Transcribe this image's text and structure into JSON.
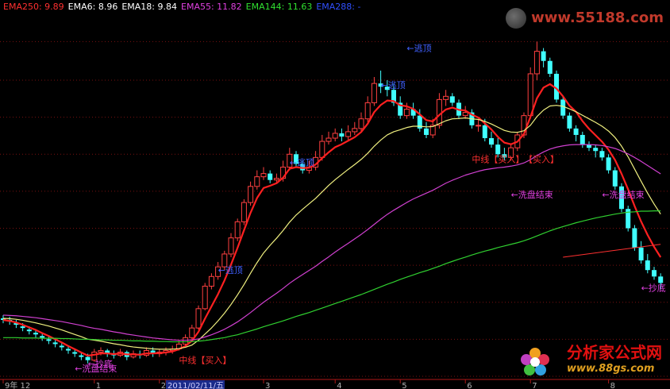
{
  "legend": [
    {
      "label": "EMA250: 9.89",
      "color": "#ff3030"
    },
    {
      "label": "EMA6: 8.96",
      "color": "#ffffff"
    },
    {
      "label": "EMA18: 9.84",
      "color": "#ffffff"
    },
    {
      "label": "EMA55: 11.82",
      "color": "#e040e0"
    },
    {
      "label": "EMA144: 11.63",
      "color": "#30e030"
    },
    {
      "label": "EMA288: -",
      "color": "#3050ff"
    }
  ],
  "watermark_top": "www.55188.com",
  "watermark_bottom_name": "分析家公式网",
  "watermark_bottom_url": "www.88gs.com",
  "annotations": [
    {
      "text": "←逃顶",
      "color": "#4060ff",
      "ci": 62,
      "price": 14.9
    },
    {
      "text": "←逃顶",
      "color": "#4060ff",
      "ci": 58,
      "price": 13.75
    },
    {
      "text": "←逃顶",
      "color": "#4060ff",
      "ci": 44,
      "price": 11.35
    },
    {
      "text": "←逃顶",
      "color": "#4060ff",
      "ci": 33,
      "price": 8.0
    },
    {
      "text": "中线【买入】",
      "color": "#ff3030",
      "ci": 72,
      "price": 11.45
    },
    {
      "text": "【买入】",
      "color": "#ff3030",
      "ci": 80,
      "price": 11.45
    },
    {
      "text": "中线【买入】",
      "color": "#ff3030",
      "ci": 27,
      "price": 5.2
    },
    {
      "text": "←洗盘结束",
      "color": "#e040e0",
      "ci": 78,
      "price": 10.35
    },
    {
      "text": "←洗盘结束",
      "color": "#e040e0",
      "ci": 92,
      "price": 10.35
    },
    {
      "text": "←抄底",
      "color": "#e040e0",
      "ci": 13,
      "price": 5.1
    },
    {
      "text": "←洗盘结束",
      "color": "#e040e0",
      "ci": 11,
      "price": 4.95
    },
    {
      "text": "←抄底",
      "color": "#e040e0",
      "ci": 98,
      "price": 7.45
    }
  ],
  "x_axis_labels": [
    {
      "text": "9年 12",
      "ci": 0
    },
    {
      "text": "1",
      "ci": 14
    },
    {
      "text": "2",
      "ci": 24
    },
    {
      "text": "2011/02/11/五",
      "ci": 25
    },
    {
      "text": "3",
      "ci": 40
    },
    {
      "text": "4",
      "ci": 51
    },
    {
      "text": "5",
      "ci": 61
    },
    {
      "text": "6",
      "ci": 71
    },
    {
      "text": "7",
      "ci": 81
    },
    {
      "text": "8",
      "ci": 93
    }
  ],
  "chart_data": {
    "type": "candlestick",
    "ylim": [
      4.7,
      16.0
    ],
    "grid_levels": [
      15.2,
      14.0,
      12.85,
      11.7,
      10.55,
      9.4,
      8.25,
      7.1,
      5.95,
      4.8
    ],
    "close": [
      6.55,
      6.5,
      6.4,
      6.3,
      6.2,
      6.1,
      6.0,
      5.9,
      5.8,
      5.7,
      5.6,
      5.5,
      5.4,
      5.3,
      5.55,
      5.6,
      5.5,
      5.45,
      5.55,
      5.4,
      5.5,
      5.45,
      5.6,
      5.5,
      5.55,
      5.6,
      5.65,
      5.8,
      6.0,
      6.3,
      6.9,
      7.6,
      7.9,
      8.2,
      8.6,
      9.1,
      9.6,
      10.2,
      10.7,
      11.0,
      11.1,
      10.9,
      10.95,
      11.3,
      11.7,
      11.4,
      11.2,
      11.3,
      11.6,
      12.1,
      12.2,
      12.35,
      12.25,
      12.4,
      12.5,
      12.8,
      13.3,
      13.9,
      13.8,
      13.7,
      13.3,
      12.9,
      13.1,
      12.9,
      12.5,
      12.3,
      12.6,
      13.4,
      13.5,
      13.3,
      12.9,
      13.0,
      12.6,
      12.6,
      12.2,
      12.0,
      11.7,
      11.6,
      11.9,
      12.3,
      12.9,
      14.2,
      14.9,
      14.6,
      14.2,
      13.4,
      12.9,
      12.5,
      12.3,
      12.0,
      11.9,
      11.8,
      11.6,
      11.2,
      10.7,
      10.0,
      9.4,
      8.8,
      8.4,
      8.1,
      7.9,
      7.7
    ],
    "open": [
      6.6,
      6.55,
      6.45,
      6.35,
      6.25,
      6.15,
      6.05,
      5.95,
      5.85,
      5.75,
      5.65,
      5.55,
      5.45,
      5.4,
      5.3,
      5.55,
      5.6,
      5.5,
      5.45,
      5.55,
      5.4,
      5.5,
      5.45,
      5.6,
      5.5,
      5.55,
      5.6,
      5.65,
      5.8,
      6.0,
      6.3,
      6.9,
      7.6,
      7.9,
      8.2,
      8.6,
      9.1,
      9.6,
      10.2,
      10.7,
      11.0,
      11.1,
      10.9,
      10.95,
      11.3,
      11.7,
      11.4,
      11.2,
      11.3,
      11.6,
      12.1,
      12.2,
      12.35,
      12.25,
      12.4,
      12.5,
      12.8,
      13.3,
      13.9,
      13.8,
      13.7,
      13.3,
      12.9,
      13.1,
      12.9,
      12.5,
      12.3,
      12.6,
      13.4,
      13.5,
      13.3,
      12.9,
      13.0,
      12.6,
      12.6,
      12.2,
      12.0,
      11.7,
      11.6,
      11.9,
      12.3,
      12.9,
      14.2,
      14.9,
      14.6,
      14.2,
      13.4,
      12.9,
      12.5,
      12.3,
      12.0,
      11.9,
      11.8,
      11.6,
      11.2,
      10.7,
      10.0,
      9.4,
      8.8,
      8.4,
      8.1,
      7.9
    ],
    "high": [
      6.7,
      6.65,
      6.55,
      6.45,
      6.35,
      6.25,
      6.15,
      6.05,
      5.95,
      5.85,
      5.75,
      5.65,
      5.55,
      5.5,
      5.65,
      5.7,
      5.65,
      5.6,
      5.65,
      5.6,
      5.6,
      5.6,
      5.7,
      5.7,
      5.65,
      5.7,
      5.75,
      5.9,
      6.1,
      6.4,
      7.0,
      7.7,
      8.0,
      8.35,
      8.7,
      9.25,
      9.7,
      10.3,
      10.85,
      11.2,
      11.3,
      11.2,
      11.1,
      11.5,
      11.9,
      11.8,
      11.5,
      11.5,
      11.8,
      12.3,
      12.4,
      12.5,
      12.5,
      12.6,
      12.7,
      13.0,
      13.5,
      14.1,
      14.3,
      14.0,
      13.9,
      13.5,
      13.3,
      13.3,
      13.1,
      12.7,
      12.8,
      13.6,
      13.7,
      13.6,
      13.4,
      13.2,
      13.1,
      12.8,
      12.8,
      12.4,
      12.2,
      11.9,
      12.0,
      12.4,
      13.0,
      14.4,
      15.2,
      15.0,
      14.7,
      14.3,
      13.5,
      13.0,
      12.6,
      12.4,
      12.1,
      12.0,
      11.9,
      11.7,
      11.3,
      10.8,
      10.1,
      9.5,
      9.0,
      8.6,
      8.2,
      8.0
    ],
    "low": [
      6.45,
      6.4,
      6.3,
      6.2,
      6.1,
      6.0,
      5.9,
      5.8,
      5.7,
      5.6,
      5.5,
      5.4,
      5.3,
      5.2,
      5.25,
      5.45,
      5.4,
      5.35,
      5.4,
      5.3,
      5.35,
      5.35,
      5.4,
      5.4,
      5.4,
      5.45,
      5.5,
      5.6,
      5.75,
      5.95,
      6.25,
      6.85,
      7.5,
      7.8,
      8.1,
      8.5,
      9.0,
      9.5,
      10.1,
      10.6,
      10.9,
      10.8,
      10.8,
      10.85,
      11.2,
      11.3,
      11.1,
      11.1,
      11.2,
      11.5,
      12.0,
      12.1,
      12.1,
      12.15,
      12.3,
      12.4,
      12.7,
      13.2,
      13.6,
      13.5,
      13.2,
      12.8,
      12.8,
      12.8,
      12.4,
      12.2,
      12.2,
      12.5,
      13.2,
      13.2,
      12.8,
      12.8,
      12.5,
      12.4,
      12.1,
      11.9,
      11.6,
      11.5,
      11.5,
      11.8,
      12.2,
      12.8,
      14.0,
      14.4,
      14.1,
      13.3,
      12.8,
      12.4,
      12.1,
      11.9,
      11.8,
      11.6,
      11.5,
      11.1,
      10.6,
      9.9,
      9.3,
      8.7,
      8.3,
      8.0,
      7.8,
      7.5
    ],
    "series": [
      {
        "name": "EMA6",
        "color": "#ff2020",
        "width": 2.2,
        "values": [
          6.55,
          6.52,
          6.47,
          6.4,
          6.32,
          6.24,
          6.14,
          6.05,
          5.95,
          5.85,
          5.74,
          5.64,
          5.54,
          5.44,
          5.47,
          5.51,
          5.51,
          5.49,
          5.51,
          5.48,
          5.48,
          5.47,
          5.51,
          5.51,
          5.52,
          5.54,
          5.57,
          5.64,
          5.74,
          5.9,
          6.18,
          6.59,
          6.97,
          7.35,
          7.78,
          8.27,
          8.79,
          9.34,
          9.88,
          10.34,
          10.65,
          10.72,
          10.8,
          10.97,
          11.25,
          11.3,
          11.27,
          11.28,
          11.38,
          11.58,
          11.76,
          11.92,
          12.01,
          12.12,
          12.23,
          12.39,
          12.65,
          13.01,
          13.23,
          13.37,
          13.35,
          13.22,
          13.19,
          13.11,
          12.94,
          12.76,
          12.72,
          12.92,
          13.09,
          13.15,
          13.08,
          13.06,
          12.93,
          12.84,
          12.66,
          12.47,
          12.24,
          12.06,
          12.01,
          12.09,
          12.33,
          12.86,
          13.44,
          13.77,
          13.88,
          13.74,
          13.5,
          13.21,
          13.02,
          12.73,
          12.49,
          12.29,
          12.09,
          11.84,
          11.52,
          11.09,
          10.61,
          10.09,
          9.61,
          9.19,
          8.82,
          8.5
        ]
      },
      {
        "name": "EMA18",
        "color": "#f0f080",
        "width": 1.2,
        "values": [
          6.6,
          6.59,
          6.57,
          6.54,
          6.5,
          6.46,
          6.41,
          6.36,
          6.3,
          6.24,
          6.17,
          6.1,
          6.03,
          5.95,
          5.92,
          5.89,
          5.85,
          5.81,
          5.78,
          5.74,
          5.71,
          5.69,
          5.67,
          5.65,
          5.64,
          5.64,
          5.64,
          5.66,
          5.7,
          5.77,
          5.92,
          6.11,
          6.3,
          6.52,
          6.76,
          7.03,
          7.33,
          7.65,
          8.0,
          8.33,
          8.63,
          8.87,
          9.09,
          9.33,
          9.59,
          9.81,
          9.99,
          10.16,
          10.33,
          10.53,
          10.73,
          10.91,
          11.07,
          11.23,
          11.38,
          11.54,
          11.73,
          11.95,
          12.14,
          12.3,
          12.4,
          12.46,
          12.53,
          12.57,
          12.57,
          12.55,
          12.56,
          12.65,
          12.74,
          12.8,
          12.81,
          12.83,
          12.8,
          12.78,
          12.72,
          12.64,
          12.54,
          12.44,
          12.39,
          12.38,
          12.43,
          12.6,
          12.87,
          13.07,
          13.2,
          13.22,
          13.19,
          13.11,
          13.02,
          12.91,
          12.8,
          12.69,
          12.57,
          12.42,
          12.22,
          11.95,
          11.62,
          11.24,
          10.86,
          10.49,
          10.15,
          9.84
        ]
      },
      {
        "name": "EMA55",
        "color": "#d040d0",
        "width": 1.2,
        "values": [
          6.7,
          6.69,
          6.68,
          6.66,
          6.64,
          6.62,
          6.59,
          6.56,
          6.53,
          6.5,
          6.46,
          6.42,
          6.38,
          6.33,
          6.29,
          6.26,
          6.22,
          6.18,
          6.15,
          6.11,
          6.08,
          6.05,
          6.02,
          5.99,
          5.97,
          5.95,
          5.93,
          5.92,
          5.92,
          5.93,
          5.96,
          6.02,
          6.09,
          6.17,
          6.26,
          6.37,
          6.49,
          6.63,
          6.78,
          6.94,
          7.1,
          7.24,
          7.38,
          7.53,
          7.69,
          7.83,
          7.96,
          8.09,
          8.22,
          8.37,
          8.51,
          8.66,
          8.8,
          8.93,
          9.07,
          9.21,
          9.36,
          9.52,
          9.68,
          9.83,
          9.96,
          10.08,
          10.2,
          10.31,
          10.4,
          10.49,
          10.58,
          10.69,
          10.8,
          10.89,
          10.97,
          11.05,
          11.11,
          11.17,
          11.22,
          11.25,
          11.28,
          11.3,
          11.33,
          11.37,
          11.43,
          11.53,
          11.66,
          11.77,
          11.86,
          11.92,
          11.96,
          11.99,
          12.0,
          12.0,
          12.0,
          11.99,
          11.97,
          11.93,
          11.88,
          11.8,
          11.71,
          11.6,
          11.48,
          11.35,
          11.22,
          11.09
        ]
      },
      {
        "name": "EMA144",
        "color": "#30d030",
        "width": 1.2,
        "values": [
          6.0,
          6.0,
          6.0,
          5.99,
          5.99,
          5.99,
          5.98,
          5.98,
          5.98,
          5.97,
          5.97,
          5.96,
          5.95,
          5.95,
          5.94,
          5.93,
          5.93,
          5.92,
          5.92,
          5.91,
          5.9,
          5.9,
          5.89,
          5.89,
          5.88,
          5.88,
          5.87,
          5.87,
          5.87,
          5.88,
          5.89,
          5.91,
          5.94,
          5.97,
          6.0,
          6.05,
          6.09,
          6.15,
          6.21,
          6.27,
          6.34,
          6.4,
          6.46,
          6.52,
          6.59,
          6.66,
          6.72,
          6.78,
          6.85,
          6.92,
          6.99,
          7.06,
          7.13,
          7.2,
          7.27,
          7.34,
          7.42,
          7.5,
          7.58,
          7.66,
          7.73,
          7.81,
          7.88,
          7.95,
          8.02,
          8.08,
          8.15,
          8.22,
          8.3,
          8.37,
          8.44,
          8.5,
          8.57,
          8.63,
          8.69,
          8.74,
          8.8,
          8.85,
          8.9,
          8.95,
          9.01,
          9.08,
          9.16,
          9.24,
          9.32,
          9.39,
          9.45,
          9.51,
          9.57,
          9.62,
          9.67,
          9.72,
          9.76,
          9.8,
          9.84,
          9.87,
          9.9,
          9.91,
          9.93,
          9.93,
          9.94,
          9.94
        ]
      }
    ],
    "ema250_segment": {
      "name": "EMA250",
      "color": "#ff3030",
      "ci_start": 86,
      "ci_end": 101,
      "start": 8.5,
      "end": 8.9
    }
  }
}
